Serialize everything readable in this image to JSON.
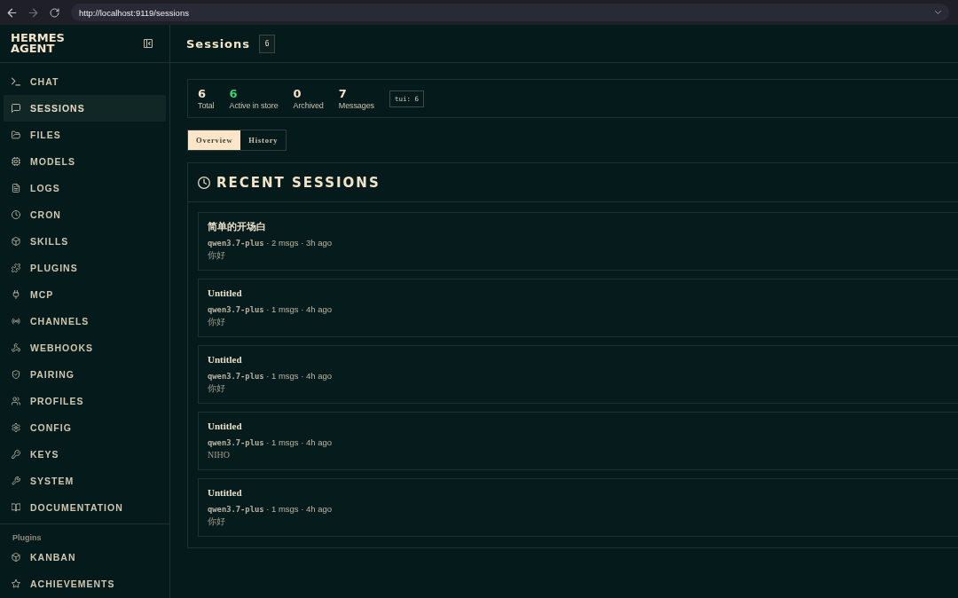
{
  "browser": {
    "url": "http://localhost:9119/sessions"
  },
  "sidebar": {
    "brand": "HERMES AGENT",
    "items": [
      {
        "label": "CHAT",
        "selected": false
      },
      {
        "label": "SESSIONS",
        "selected": true
      },
      {
        "label": "FILES",
        "selected": false
      },
      {
        "label": "MODELS",
        "selected": false
      },
      {
        "label": "LOGS",
        "selected": false
      },
      {
        "label": "CRON",
        "selected": false
      },
      {
        "label": "SKILLS",
        "selected": false
      },
      {
        "label": "PLUGINS",
        "selected": false
      },
      {
        "label": "MCP",
        "selected": false
      },
      {
        "label": "CHANNELS",
        "selected": false
      },
      {
        "label": "WEBHOOKS",
        "selected": false
      },
      {
        "label": "PAIRING",
        "selected": false
      },
      {
        "label": "PROFILES",
        "selected": false
      },
      {
        "label": "CONFIG",
        "selected": false
      },
      {
        "label": "KEYS",
        "selected": false
      },
      {
        "label": "SYSTEM",
        "selected": false
      },
      {
        "label": "DOCUMENTATION",
        "selected": false
      }
    ],
    "section": {
      "label": "Plugins",
      "items": [
        {
          "label": "KANBAN",
          "selected": false
        },
        {
          "label": "ACHIEVEMENTS",
          "selected": false
        }
      ]
    }
  },
  "header": {
    "title": "Sessions",
    "count": "6"
  },
  "stats": {
    "items": [
      {
        "value": "6",
        "label": "Total",
        "color": "#f3e3c8"
      },
      {
        "value": "6",
        "label": "Active in store",
        "color": "#3fcf78"
      },
      {
        "value": "0",
        "label": "Archived",
        "color": "#f3e3c8"
      },
      {
        "value": "7",
        "label": "Messages",
        "color": "#f3e3c8"
      }
    ],
    "tag": "tui: 6"
  },
  "tabs": [
    {
      "label": "Overview",
      "selected": true
    },
    {
      "label": "History",
      "selected": false
    }
  ],
  "recent_sessions": {
    "title": "RECENT SESSIONS",
    "sessions": [
      {
        "title": "简单的开场白",
        "meta": "**qwen3.7-plus** · 2 msgs · 3h ago",
        "preview": "你好"
      },
      {
        "title": "Untitled",
        "meta": "**qwen3.7-plus** · 1 msgs · 4h ago",
        "preview": "你好"
      },
      {
        "title": "Untitled",
        "meta": "**qwen3.7-plus** · 1 msgs · 4h ago",
        "preview": "你好"
      },
      {
        "title": "Untitled",
        "meta": "**qwen3.7-plus** · 1 msgs · 4h ago",
        "preview": "NIHO"
      },
      {
        "title": "Untitled",
        "meta": "**qwen3.7-plus** · 1 msgs · 4h ago",
        "preview": "你好"
      }
    ]
  }
}
